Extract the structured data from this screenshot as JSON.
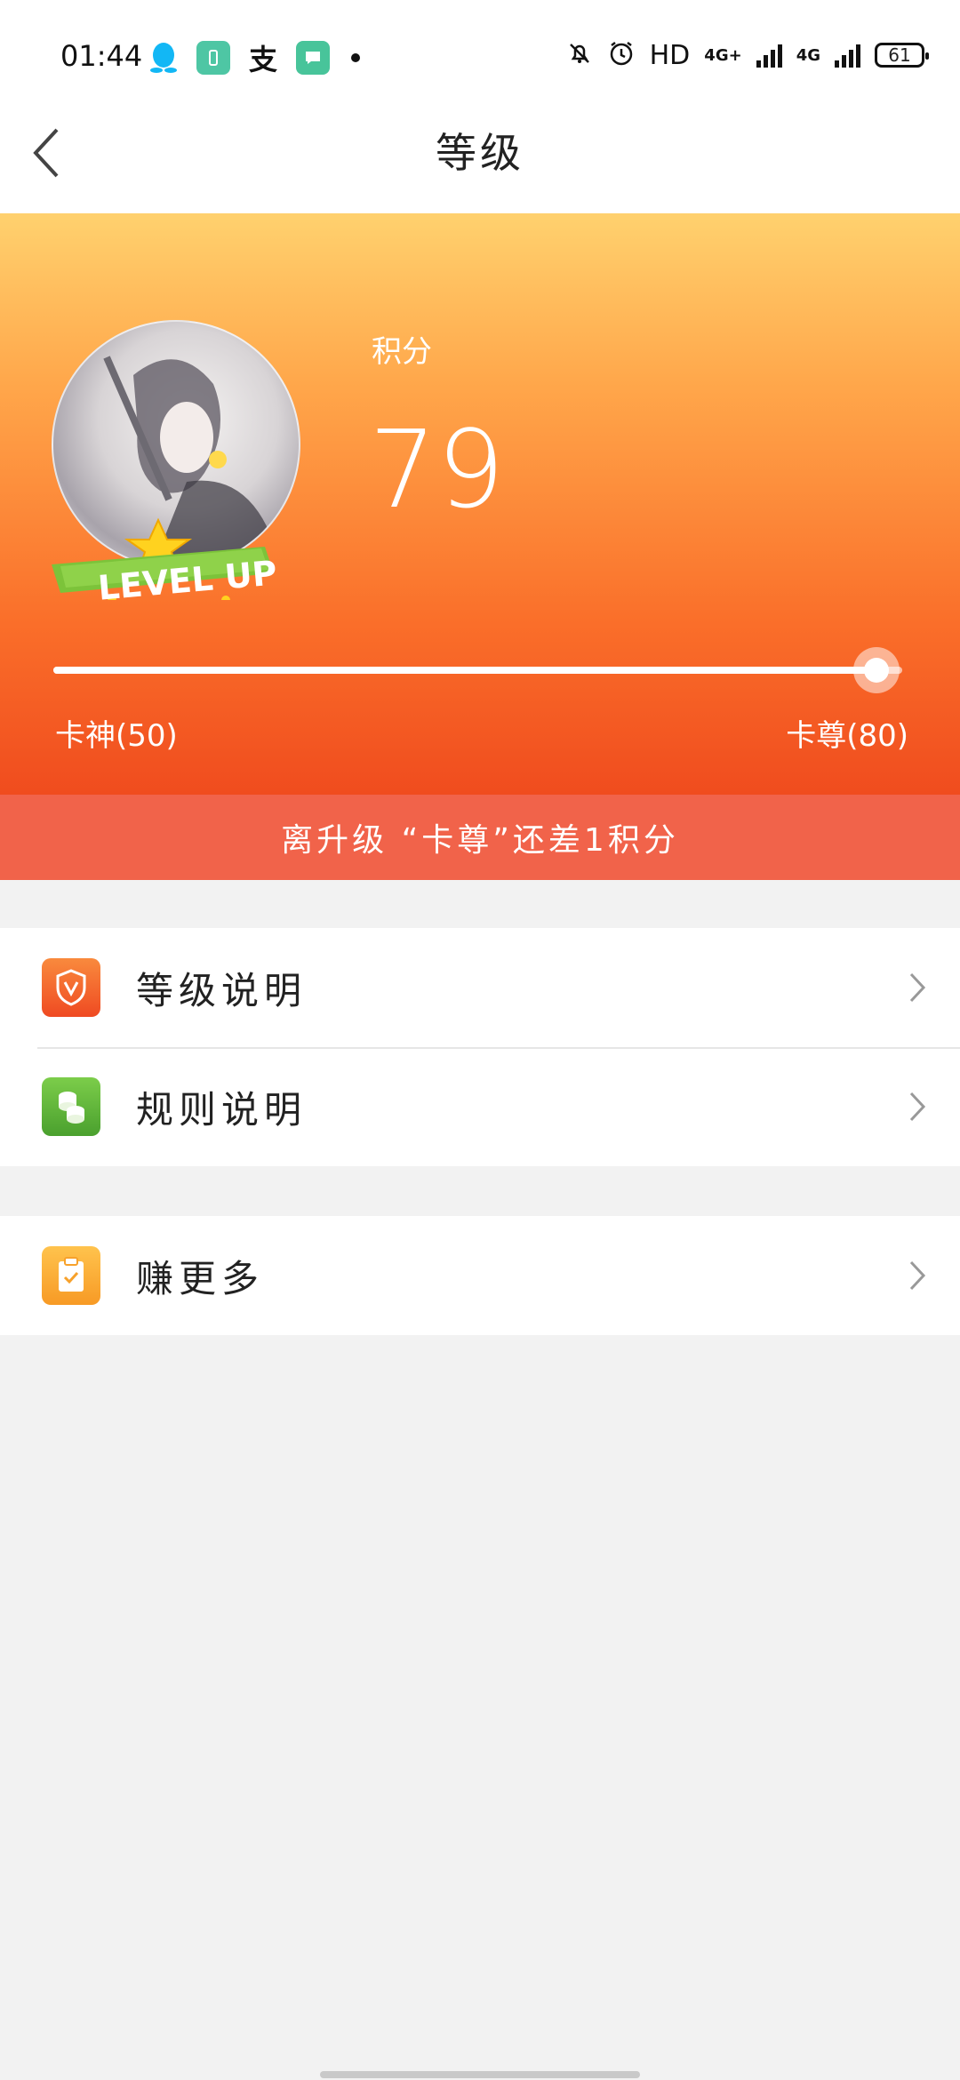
{
  "status_bar": {
    "time": "01:44",
    "hd_label": "HD",
    "net1": "4G+",
    "net2": "4G",
    "battery": "61",
    "zhi_char": "支"
  },
  "header": {
    "title": "等级",
    "back_icon": "chevron-left-icon"
  },
  "hero": {
    "points_label": "积分",
    "points_value": "79",
    "badge_text": "LEVEL UP",
    "progress_fraction": 0.97,
    "current_level": "卡神(50)",
    "next_level": "卡尊(80)",
    "hint": "离升级 “卡尊”还差1积分"
  },
  "menu": {
    "group1": [
      {
        "label": "等级说明",
        "icon": "shield-icon"
      },
      {
        "label": "规则说明",
        "icon": "coins-icon"
      }
    ],
    "group2": [
      {
        "label": "赚更多",
        "icon": "clipboard-check-icon"
      }
    ]
  },
  "colors": {
    "hero_top": "#ffd16e",
    "hero_bottom": "#f04c1e",
    "hint_bar": "#f1634a",
    "background": "#f2f2f2"
  }
}
